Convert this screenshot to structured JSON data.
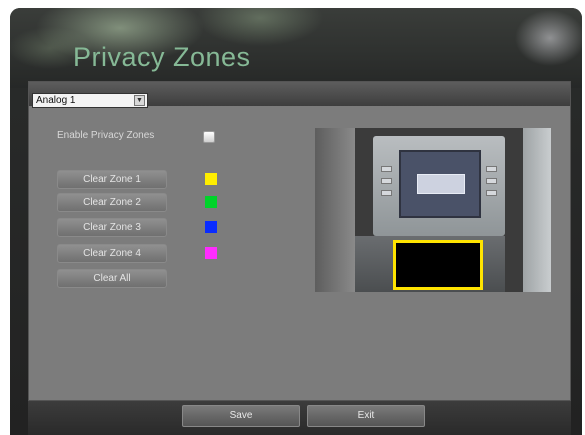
{
  "window": {
    "title": "Privacy Zones"
  },
  "channel": {
    "selected": "Analog 1",
    "arrow_icon": "chevron-down-icon"
  },
  "enable": {
    "label": "Enable Privacy Zones",
    "checked": false
  },
  "zones": [
    {
      "label": "Clear Zone 1",
      "color": "#ffee00"
    },
    {
      "label": "Clear Zone 2",
      "color": "#00d32a"
    },
    {
      "label": "Clear Zone 3",
      "color": "#0a2cff"
    },
    {
      "label": "Clear Zone 4",
      "color": "#ff2cff"
    }
  ],
  "clear_all_label": "Clear All",
  "footer": {
    "save_label": "Save",
    "exit_label": "Exit"
  }
}
